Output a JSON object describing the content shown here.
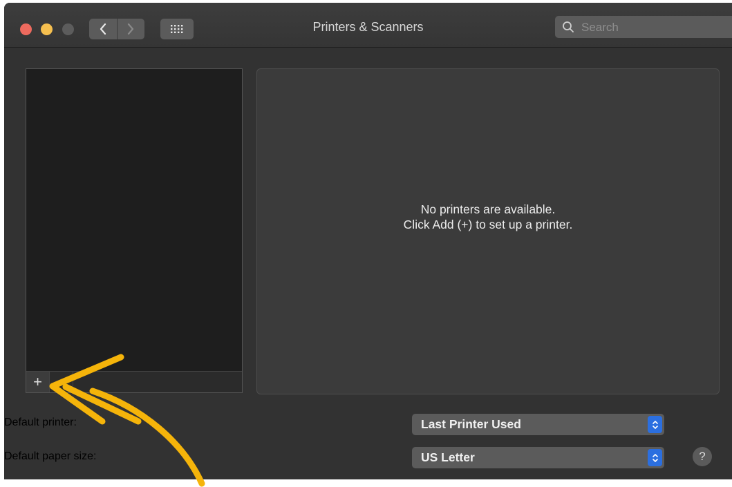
{
  "window": {
    "title": "Printers & Scanners",
    "nav_back": "‹",
    "nav_forward": "›"
  },
  "search": {
    "placeholder": "Search"
  },
  "printer_list": {
    "add_label": "+",
    "remove_label": "−"
  },
  "detail": {
    "empty_line1": "No printers are available.",
    "empty_line2": "Click Add (+) to set up a printer."
  },
  "defaults": {
    "printer_label": "Default printer:",
    "printer_value": "Last Printer Used",
    "paper_label": "Default paper size:",
    "paper_value": "US Letter"
  },
  "help_label": "?",
  "colors": {
    "annotation_arrow": "#f5b40a",
    "popup_accent": "#2b6fe0",
    "close_light": "#ed6a5e",
    "minimize_light": "#f5bf4f"
  }
}
